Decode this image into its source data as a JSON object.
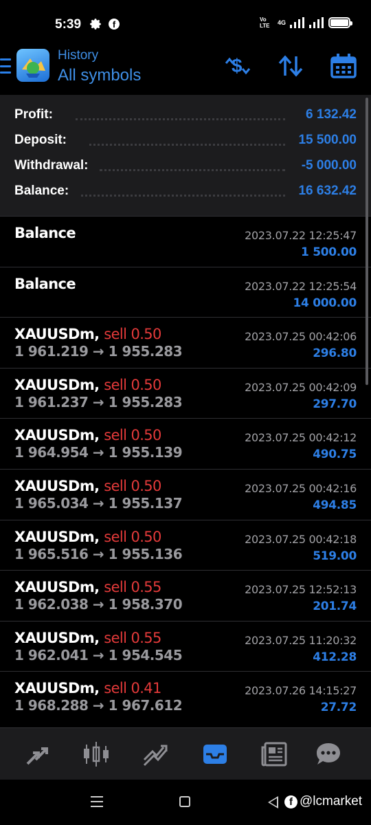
{
  "status_bar": {
    "time": "5:39",
    "network_label": "4G",
    "volte_label": "Vo LTE"
  },
  "header": {
    "title": "History",
    "subtitle": "All symbols"
  },
  "summary": [
    {
      "label": "Profit:",
      "value": "6 132.42"
    },
    {
      "label": "Deposit:",
      "value": "15 500.00"
    },
    {
      "label": "Withdrawal:",
      "value": "-5 000.00"
    },
    {
      "label": "Balance:",
      "value": "16 632.42"
    }
  ],
  "deals": [
    {
      "symbol": "Balance",
      "action": "",
      "prices": "",
      "datetime": "2023.07.22 12:25:47",
      "amount": "1 500.00"
    },
    {
      "symbol": "Balance",
      "action": "",
      "prices": "",
      "datetime": "2023.07.22 12:25:54",
      "amount": "14 000.00"
    },
    {
      "symbol": "XAUUSDm,",
      "action": "sell 0.50",
      "prices": "1 961.219 → 1 955.283",
      "datetime": "2023.07.25 00:42:06",
      "amount": "296.80"
    },
    {
      "symbol": "XAUUSDm,",
      "action": "sell 0.50",
      "prices": "1 961.237 → 1 955.283",
      "datetime": "2023.07.25 00:42:09",
      "amount": "297.70"
    },
    {
      "symbol": "XAUUSDm,",
      "action": "sell 0.50",
      "prices": "1 964.954 → 1 955.139",
      "datetime": "2023.07.25 00:42:12",
      "amount": "490.75"
    },
    {
      "symbol": "XAUUSDm,",
      "action": "sell 0.50",
      "prices": "1 965.034 → 1 955.137",
      "datetime": "2023.07.25 00:42:16",
      "amount": "494.85"
    },
    {
      "symbol": "XAUUSDm,",
      "action": "sell 0.50",
      "prices": "1 965.516 → 1 955.136",
      "datetime": "2023.07.25 00:42:18",
      "amount": "519.00"
    },
    {
      "symbol": "XAUUSDm,",
      "action": "sell 0.55",
      "prices": "1 962.038 → 1 958.370",
      "datetime": "2023.07.25 12:52:13",
      "amount": "201.74"
    },
    {
      "symbol": "XAUUSDm,",
      "action": "sell 0.55",
      "prices": "1 962.041 → 1 954.545",
      "datetime": "2023.07.25 11:20:32",
      "amount": "412.28"
    },
    {
      "symbol": "XAUUSDm,",
      "action": "sell 0.41",
      "prices": "1 968.288 → 1 967.612",
      "datetime": "2023.07.26 14:15:27",
      "amount": "27.72"
    }
  ],
  "bottom_nav": [
    {
      "name": "quotes",
      "icon": "quotes-arrows-icon"
    },
    {
      "name": "chart",
      "icon": "candlestick-icon"
    },
    {
      "name": "trade",
      "icon": "trend-icon"
    },
    {
      "name": "history",
      "icon": "inbox-icon",
      "active": true
    },
    {
      "name": "news",
      "icon": "newspaper-icon"
    },
    {
      "name": "messages",
      "icon": "chat-icon"
    }
  ],
  "watermark": {
    "text": "@lcmarket",
    "fb_glyph": "f"
  },
  "colors": {
    "accent_blue": "#2d7fe6",
    "sell_red": "#e43a3a",
    "background": "#000000",
    "panel": "#1c1c1e"
  }
}
